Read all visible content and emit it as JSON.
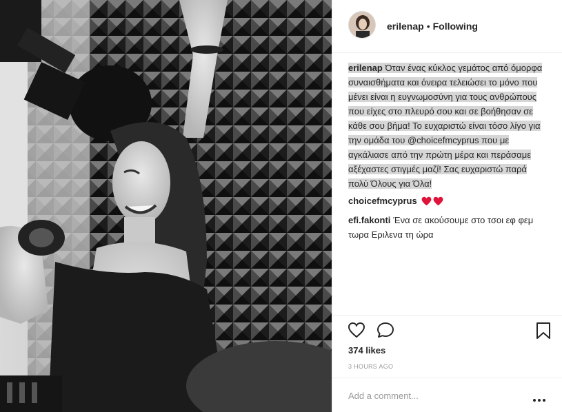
{
  "post": {
    "author": "erilenap",
    "follow_status": "Following",
    "separator": "•",
    "caption_user": "erilenap",
    "caption_text": "Όταν ένας κύκλος γεμάτος από όμορφα συναισθήματα και όνειρα τελειώσει το μόνο που μένει είναι η ευγνωμοσύνη για τους ανθρώπους που είχες στο πλευρό σου και σε βοήθησαν σε κάθε σου βήμα! Το ευχαριστώ είναι τόσο λίγο για την ομάδα του @choicefmcyprus που με αγκάλιασε από την πρώτη μέρα και περάσαμε αξέχαστες στιγμές μαζί! Σας ευχαριστώ παρά πολύ Όλους για Όλα!",
    "likes": "374 likes",
    "timestamp": "3 HOURS AGO"
  },
  "comments": [
    {
      "user": "choicefmcyprus",
      "text": "",
      "emoji": [
        "red-heart-icon",
        "red-heart-icon"
      ]
    },
    {
      "user": "efi.fakonti",
      "text": "Ένα σε ακούσουμε στο τσοι εφ φεμ τωρα Εριλενα τη ώρα"
    }
  ],
  "comment_box": {
    "placeholder": "Add a comment..."
  },
  "icons": {
    "like": "heart-outline-icon",
    "comment": "speech-bubble-icon",
    "save": "bookmark-icon",
    "more": "ellipsis-icon",
    "reaction_heart_color": "#e0143a"
  },
  "colors": {
    "text": "#262626",
    "muted": "#999999",
    "border": "#efefef",
    "caption_highlight": "#d6d6d6"
  }
}
